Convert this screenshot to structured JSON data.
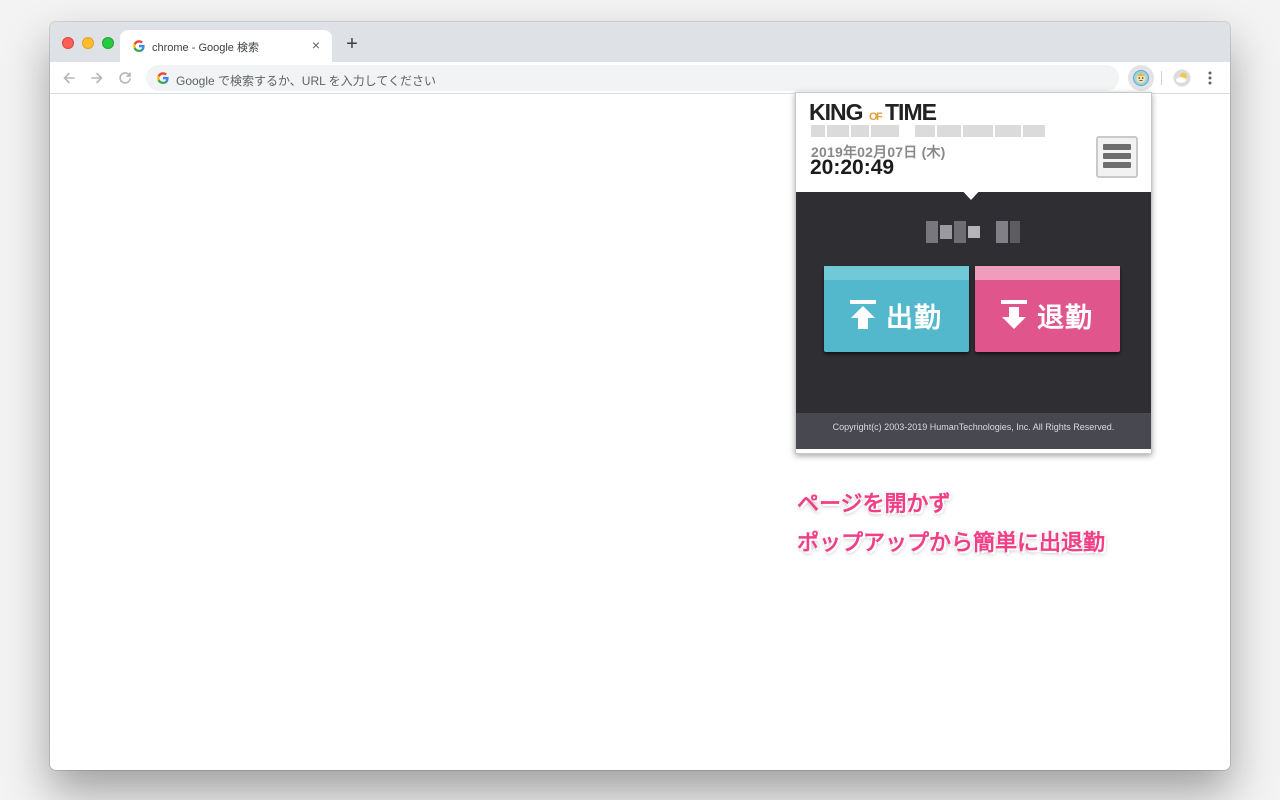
{
  "browser": {
    "tab": {
      "title": "chrome - Google 検索",
      "close_glyph": "×"
    },
    "new_tab_glyph": "+",
    "omnibox": {
      "placeholder": "Google で検索するか、URL を入力してください"
    },
    "extensions": [
      {
        "name": "king-of-time-extension-icon"
      },
      {
        "name": "weather-extension-icon"
      }
    ]
  },
  "popup": {
    "logo": "KING OF TIME",
    "date": "2019年02月07日 (木)",
    "time": "20:20:49",
    "clock_in": {
      "label": "出勤",
      "color": "#53b8cb",
      "icon": "arrow-up-icon"
    },
    "clock_out": {
      "label": "退勤",
      "color": "#e0568c",
      "icon": "arrow-down-icon"
    },
    "copyright": "Copyright(c) 2003-2019 HumanTechnologies, Inc. All Rights Reserved."
  },
  "captions": {
    "line1": "ページを開かず",
    "line2": "ポップアップから簡単に出退勤",
    "color": "#f03f87"
  }
}
